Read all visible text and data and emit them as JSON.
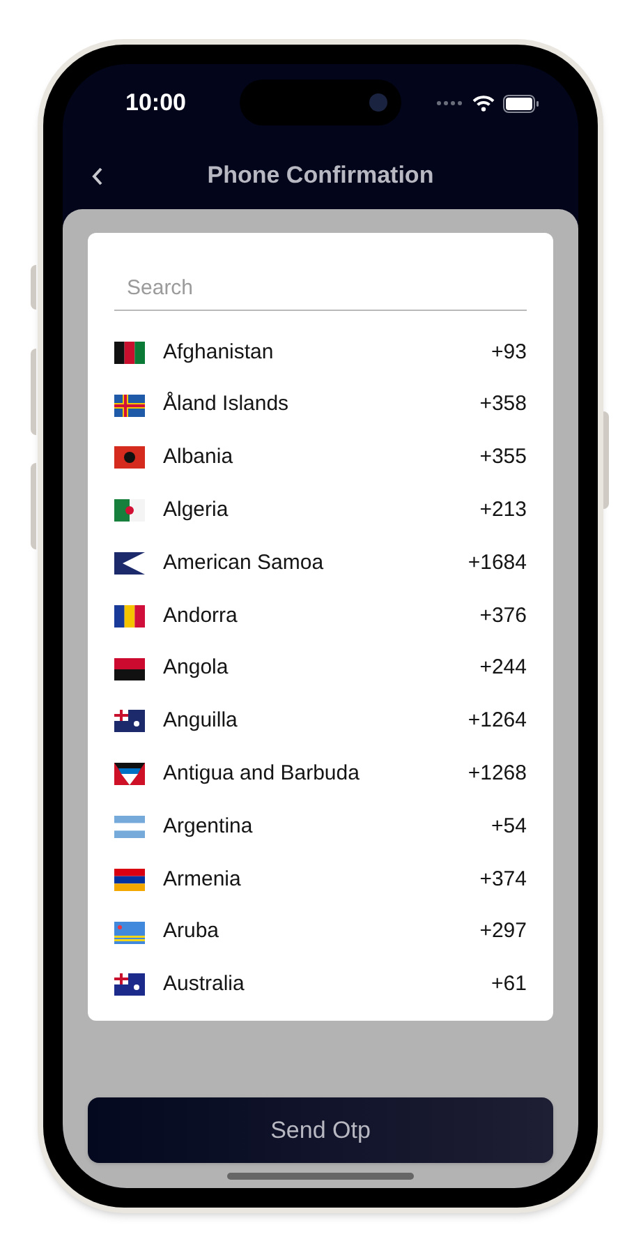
{
  "status_bar": {
    "time": "10:00"
  },
  "header": {
    "title": "Phone Confirmation"
  },
  "search": {
    "placeholder": "Search"
  },
  "countries": [
    {
      "name": "Afghanistan",
      "code": "+93"
    },
    {
      "name": "Åland Islands",
      "code": "+358"
    },
    {
      "name": "Albania",
      "code": "+355"
    },
    {
      "name": "Algeria",
      "code": "+213"
    },
    {
      "name": "American Samoa",
      "code": "+1684"
    },
    {
      "name": "Andorra",
      "code": "+376"
    },
    {
      "name": "Angola",
      "code": "+244"
    },
    {
      "name": "Anguilla",
      "code": "+1264"
    },
    {
      "name": "Antigua and Barbuda",
      "code": "+1268"
    },
    {
      "name": "Argentina",
      "code": "+54"
    },
    {
      "name": "Armenia",
      "code": "+374"
    },
    {
      "name": "Aruba",
      "code": "+297"
    },
    {
      "name": "Australia",
      "code": "+61"
    }
  ],
  "button": {
    "label": "Send Otp"
  }
}
